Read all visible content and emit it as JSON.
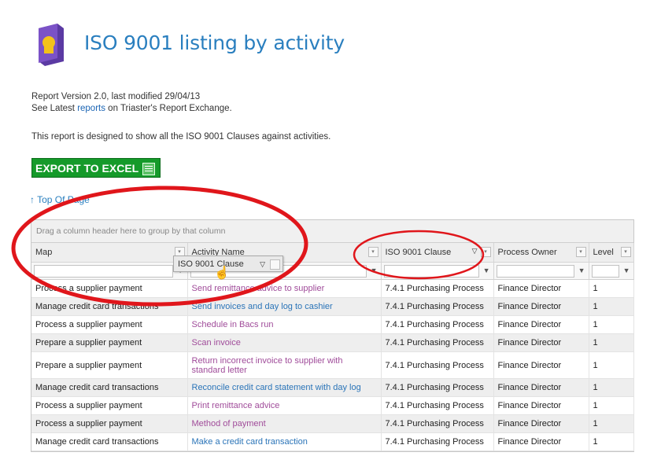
{
  "title": "ISO 9001 listing by activity",
  "meta": {
    "version_line": "Report Version 2.0, last modified 29/04/13",
    "see_prefix": "See Latest ",
    "see_link": "reports",
    "see_suffix": " on Triaster's Report Exchange."
  },
  "description": "This report is designed to show all the ISO 9001 Clauses against activities.",
  "export_label": "EXPORT TO EXCEL",
  "top_link": "↑ Top Of Page",
  "grid": {
    "group_hint": "Drag a column header here to group by that column",
    "columns": [
      "Map",
      "Activity Name",
      "ISO 9001 Clause",
      "Process Owner",
      "Level"
    ],
    "dragging_header": "ISO 9001 Clause",
    "rows": [
      {
        "map": "Process a supplier payment",
        "activity": "Send remittance advice to supplier",
        "clause": "7.4.1 Purchasing Process",
        "owner": "Finance Director",
        "level": "1"
      },
      {
        "map": "Manage credit card transactions",
        "activity": "Send invoices and day log to cashier",
        "clause": "7.4.1 Purchasing Process",
        "owner": "Finance Director",
        "level": "1"
      },
      {
        "map": "Process a supplier payment",
        "activity": "Schedule in Bacs run",
        "clause": "7.4.1 Purchasing Process",
        "owner": "Finance Director",
        "level": "1"
      },
      {
        "map": "Prepare a supplier payment",
        "activity": "Scan invoice",
        "clause": "7.4.1 Purchasing Process",
        "owner": "Finance Director",
        "level": "1"
      },
      {
        "map": "Prepare a supplier payment",
        "activity": "Return incorrect invoice to supplier with standard letter",
        "clause": "7.4.1 Purchasing Process",
        "owner": "Finance Director",
        "level": "1"
      },
      {
        "map": "Manage credit card transactions",
        "activity": "Reconcile credit card statement with day log",
        "clause": "7.4.1 Purchasing Process",
        "owner": "Finance Director",
        "level": "1"
      },
      {
        "map": "Process a supplier payment",
        "activity": "Print remittance advice",
        "clause": "7.4.1 Purchasing Process",
        "owner": "Finance Director",
        "level": "1"
      },
      {
        "map": "Process a supplier payment",
        "activity": "Method of payment",
        "clause": "7.4.1 Purchasing Process",
        "owner": "Finance Director",
        "level": "1"
      },
      {
        "map": "Manage credit card transactions",
        "activity": "Make a credit card transaction",
        "clause": "7.4.1 Purchasing Process",
        "owner": "Finance Director",
        "level": "1"
      }
    ]
  },
  "colors": {
    "title": "#2a7fbf",
    "export": "#159a2a",
    "annotation": "#e0161b",
    "activity_purple": "#a04c9a",
    "activity_blue": "#2a74b8"
  }
}
